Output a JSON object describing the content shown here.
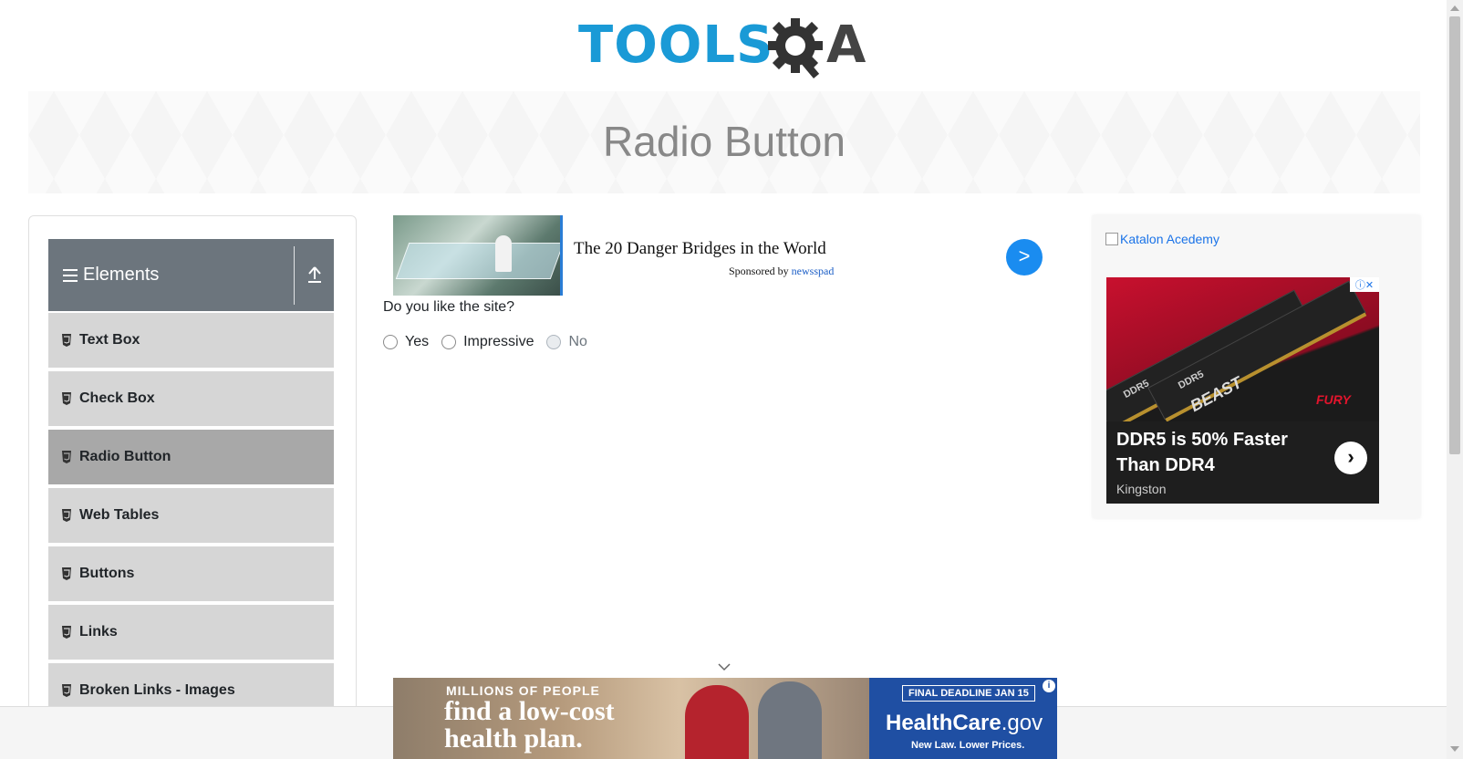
{
  "header": {
    "logo_tools": "TOOLS",
    "logo_a": "A",
    "brand_color": "#1a9ad6"
  },
  "banner": {
    "title": "Radio Button"
  },
  "sidebar": {
    "group_title": "Elements",
    "group_icon": "hamburger-icon",
    "toggle_icon": "collapse-up-icon",
    "items": [
      {
        "label": "Text Box",
        "icon": "html5-icon",
        "active": false
      },
      {
        "label": "Check Box",
        "icon": "html5-icon",
        "active": false
      },
      {
        "label": "Radio Button",
        "icon": "html5-icon",
        "active": true
      },
      {
        "label": "Web Tables",
        "icon": "html5-icon",
        "active": false
      },
      {
        "label": "Buttons",
        "icon": "html5-icon",
        "active": false
      },
      {
        "label": "Links",
        "icon": "html5-icon",
        "active": false
      },
      {
        "label": "Broken Links - Images",
        "icon": "html5-icon",
        "active": false
      }
    ]
  },
  "top_ad": {
    "headline": "The 20 Danger Bridges in the World",
    "sponsored_prefix": "Sponsored by",
    "sponsor": "newsspad",
    "go_label": ">"
  },
  "main": {
    "question": "Do you like the site?",
    "options": [
      {
        "label": "Yes",
        "disabled": false,
        "checked": false
      },
      {
        "label": "Impressive",
        "disabled": false,
        "checked": false
      },
      {
        "label": "No",
        "disabled": true,
        "checked": false
      }
    ]
  },
  "right_ad": {
    "katalon_alt": "Katalon Acedemy",
    "stick_label": "DDR5",
    "beast": "BEAST",
    "fury": "FURY",
    "headline_line1": "DDR5 is 50% Faster",
    "headline_line2": "Than DDR4",
    "brand": "Kingston",
    "arrow": "›",
    "adchoices": "ⓘ✕"
  },
  "bottom_ad": {
    "line1": "MILLIONS OF PEOPLE",
    "line2": "find a low-cost",
    "line3": "health plan.",
    "deadline": "FINAL DEADLINE JAN 15",
    "site_bold": "HealthCare",
    "site_tld": ".gov",
    "tagline": "New Law. Lower Prices.",
    "info": "i"
  },
  "colors": {
    "sidebar_header": "#6c757d",
    "menu_item": "#d6d6d6",
    "menu_item_active": "#a8a8a8",
    "accent_blue": "#1a8cf0"
  }
}
